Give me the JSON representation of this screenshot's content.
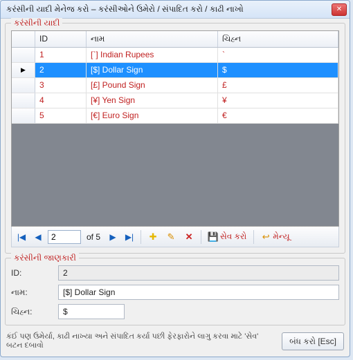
{
  "window": {
    "title": "કરંસીની યાદી મેનેજ કરો – કરંસીઓને ઉમેરો / સંપાદિત કરો / કાઢી નાખો"
  },
  "list_group_title": "કરંસીની યાદી",
  "columns": {
    "id": "ID",
    "name": "નામ",
    "sign": "ચિહ્ન"
  },
  "rows": [
    {
      "id": "1",
      "name": "[`] Indian Rupees",
      "sign": "`"
    },
    {
      "id": "2",
      "name": "[$] Dollar Sign",
      "sign": "$"
    },
    {
      "id": "3",
      "name": "[£] Pound Sign",
      "sign": "£"
    },
    {
      "id": "4",
      "name": "[¥] Yen Sign",
      "sign": "¥"
    },
    {
      "id": "5",
      "name": "[€] Euro Sign",
      "sign": "€"
    }
  ],
  "selected_index": 1,
  "nav": {
    "current": "2",
    "of_text": "of 5",
    "save_label": "સેવ કરો",
    "menu_label": "મેન્યૂ"
  },
  "details": {
    "group_title": "કરંસીની જાણકારી",
    "id_label": "ID:",
    "name_label": "નામ:",
    "sign_label": "ચિહ્ન:",
    "id_value": "2",
    "name_value": "[$] Dollar Sign",
    "sign_value": "$"
  },
  "footer": {
    "hint": "કંઈ પણ ઉમેર્યા, કાઢી નાખ્યા અને સંપાદિત કર્યા પછી ફેરફારોને લાગુ કરવા માટે 'સેવ' બટન દબાવો",
    "close_label": "બંધ કરો [Esc]"
  }
}
